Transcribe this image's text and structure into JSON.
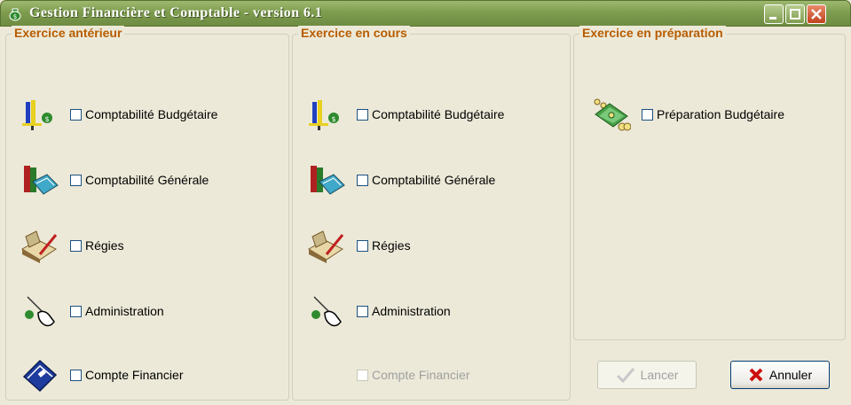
{
  "window": {
    "title": "Gestion Financière et Comptable - version 6.1",
    "icon": "money-bag-icon"
  },
  "sections": {
    "anterieur": {
      "label": "Exercice antérieur",
      "items": [
        {
          "label": "Comptabilité Budgétaire",
          "checked": false,
          "enabled": true,
          "icon": "budget-icon"
        },
        {
          "label": "Comptabilité Générale",
          "checked": false,
          "enabled": true,
          "icon": "books-icon"
        },
        {
          "label": "Régies",
          "checked": false,
          "enabled": true,
          "icon": "ledger-pen-icon"
        },
        {
          "label": "Administration",
          "checked": false,
          "enabled": true,
          "icon": "hand-admin-icon"
        },
        {
          "label": "Compte Financier",
          "checked": false,
          "enabled": true,
          "icon": "blue-book-icon"
        }
      ]
    },
    "en_cours": {
      "label": "Exercice en cours",
      "items": [
        {
          "label": "Comptabilité Budgétaire",
          "checked": false,
          "enabled": true,
          "icon": "budget-icon"
        },
        {
          "label": "Comptabilité Générale",
          "checked": false,
          "enabled": true,
          "icon": "books-icon"
        },
        {
          "label": "Régies",
          "checked": false,
          "enabled": true,
          "icon": "ledger-pen-icon"
        },
        {
          "label": "Administration",
          "checked": false,
          "enabled": true,
          "icon": "hand-admin-icon"
        },
        {
          "label": "Compte Financier",
          "checked": false,
          "enabled": false
        }
      ]
    },
    "preparation": {
      "label": "Exercice en préparation",
      "items": [
        {
          "label": "Préparation Budgétaire",
          "checked": false,
          "enabled": true,
          "icon": "money-coins-icon"
        }
      ]
    }
  },
  "buttons": {
    "lancer": {
      "label": "Lancer",
      "enabled": false,
      "icon": "checkmark-icon"
    },
    "annuler": {
      "label": "Annuler",
      "enabled": true,
      "icon": "red-x-icon"
    }
  },
  "colors": {
    "title_bar": "#7F9D4F",
    "section_label": "#B85C00",
    "window_bg": "#ECE9D8"
  }
}
